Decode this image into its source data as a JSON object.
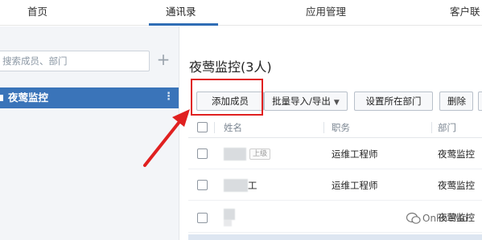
{
  "nav": {
    "items": [
      "首页",
      "通讯录",
      "应用管理",
      "客户联"
    ],
    "active_index": 1,
    "accent_color": "#2f6db5"
  },
  "sidebar": {
    "search_placeholder": "搜索成员、部门",
    "add_symbol": "+",
    "departments": [
      {
        "label": "夜莺监控",
        "selected": true
      }
    ],
    "more_symbol": "⋮",
    "selected_color": "#3a74b9"
  },
  "main": {
    "title": "夜莺监控(3人)",
    "toolbar": {
      "add_member": "添加成员",
      "batch_import_export": "批量导入/导出",
      "set_department": "设置所在部门",
      "delete": "删除"
    },
    "table": {
      "headers": [
        "姓名",
        "职务",
        "部门"
      ],
      "rows": [
        {
          "name_suffix": "",
          "tag": "上级",
          "title": "运维工程师",
          "department": "夜莺监控"
        },
        {
          "name_suffix": "工",
          "tag": "",
          "title": "运维工程师",
          "department": "夜莺监控"
        },
        {
          "name_suffix": "",
          "tag": "",
          "title": "",
          "department": "夜莺监控"
        }
      ]
    },
    "highlight_color": "#e02020"
  },
  "watermark": {
    "text": "OnlineMo"
  }
}
